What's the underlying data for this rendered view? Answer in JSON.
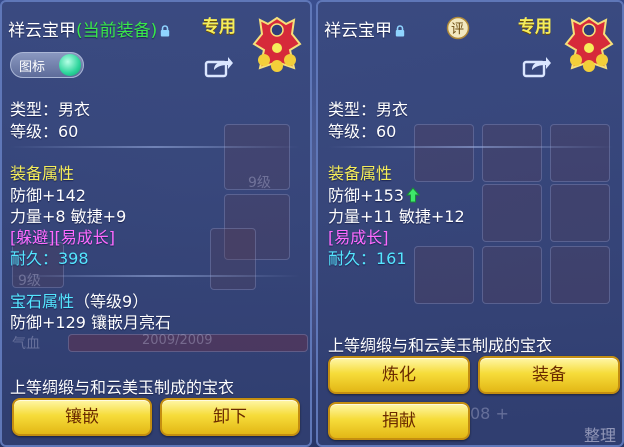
{
  "left": {
    "title_name": "祥云宝甲",
    "title_suffix": "(当前装备)",
    "exclusive": "专用",
    "tag_label": "图标",
    "type": "类型：男衣",
    "level": "等级：60",
    "attr_header": "装备属性",
    "defense": "防御+142",
    "stats": "力量+8 敏捷+9",
    "specials": "[躲避][易成长]",
    "durability": "耐久：398",
    "gem_header": "宝石属性",
    "gem_level": "（等级9）",
    "gem_effect": "防御+129 镶嵌月亮石",
    "desc": "上等绸缎与和云美玉制成的宝衣",
    "btn_inlay": "镶嵌",
    "btn_unequip": "卸下"
  },
  "right": {
    "title_name": "祥云宝甲",
    "rating_badge": "评",
    "exclusive": "专用",
    "type": "类型：男衣",
    "level": "等级：60",
    "attr_header": "装备属性",
    "defense": "防御+153",
    "stats": "力量+11 敏捷+12",
    "specials": "[易成长]",
    "durability": "耐久：161",
    "desc": "上等绸缎与和云美玉制成的宝衣",
    "btn_refine": "炼化",
    "btn_equip": "装备",
    "btn_donate": "捐献"
  },
  "background": {
    "bar_text": "2009/2009",
    "qi_label": "气血",
    "slot_nine_a": "9级",
    "slot_nine_b": "9级",
    "sort_label": "整理",
    "count_label": "08 +"
  },
  "colors": {
    "title": "#ffffff",
    "equipped": "#39e84a",
    "header": "#f6ee5a",
    "special": "#ff6bff",
    "durability": "#55e6ff",
    "button": "#f6dc3a"
  }
}
